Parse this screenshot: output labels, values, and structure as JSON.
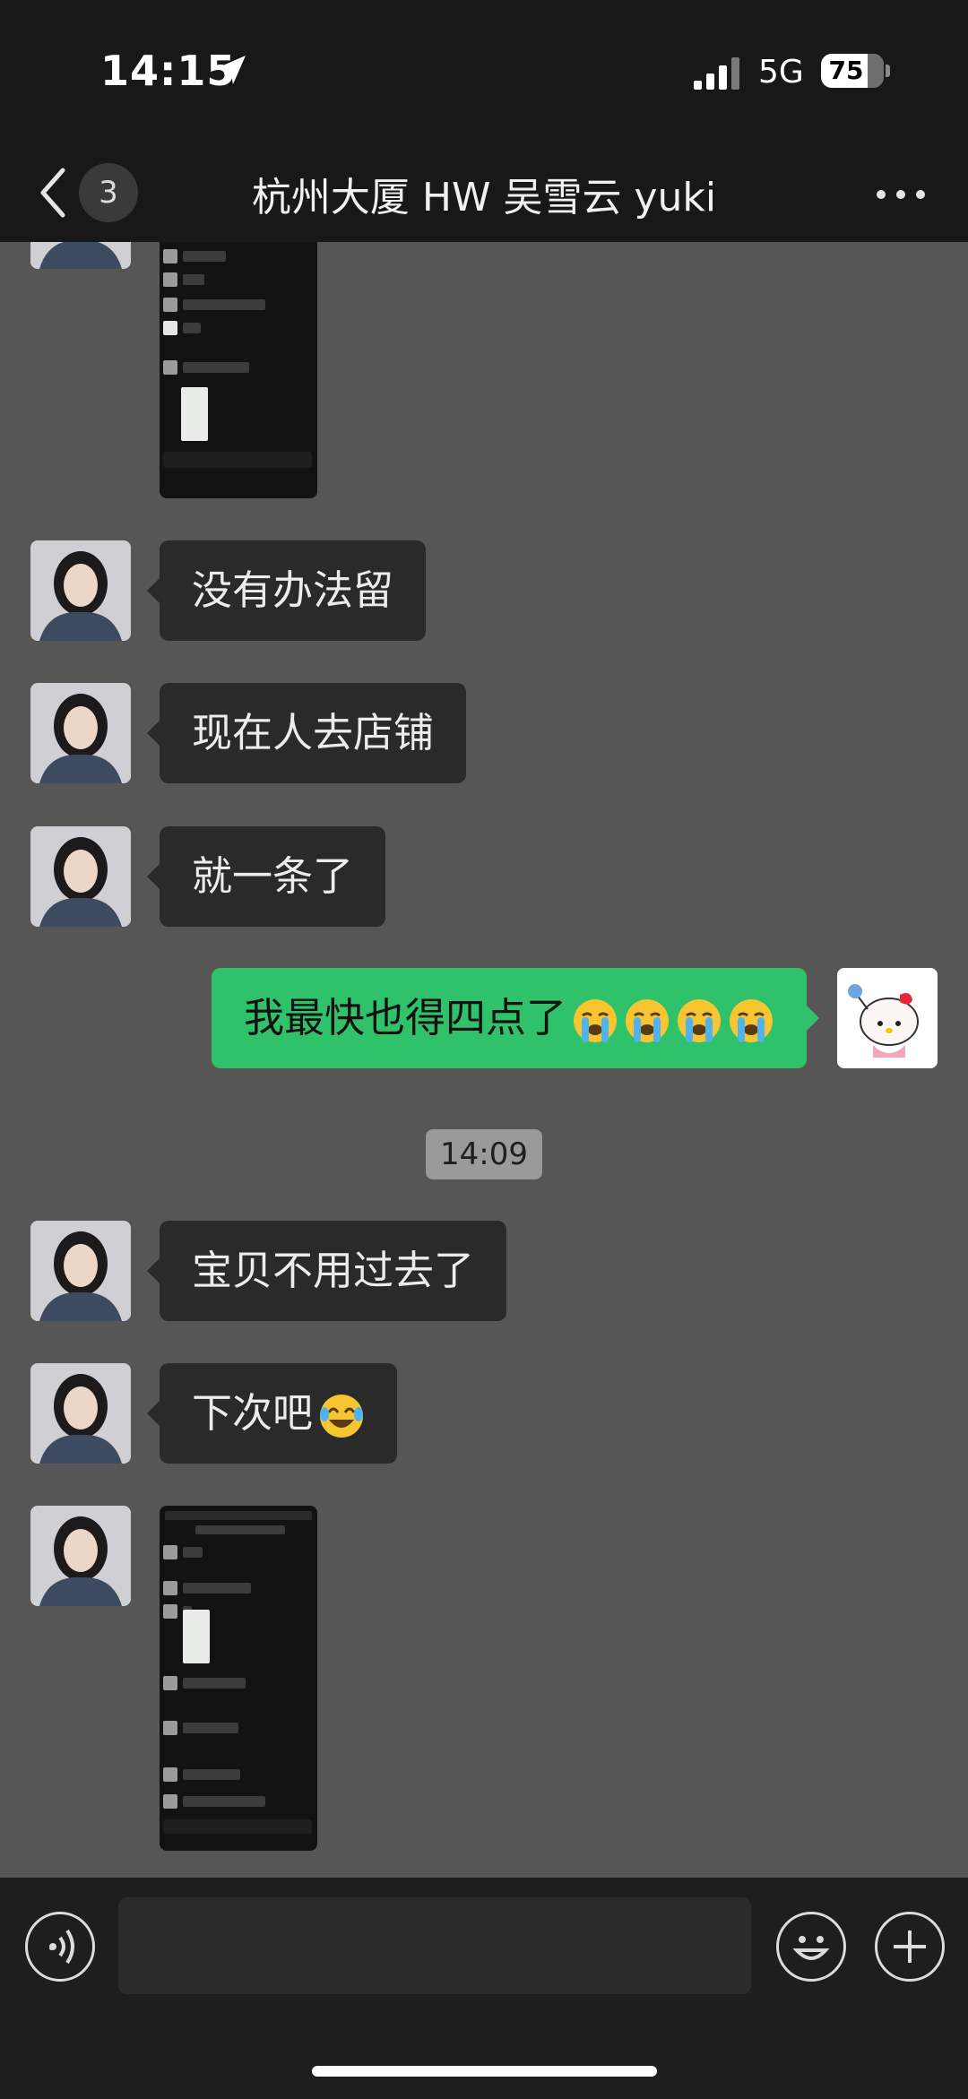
{
  "status_bar": {
    "time": "14:15",
    "network": "5G",
    "battery": "75",
    "location_icon": "location-arrow-icon",
    "signal_icon": "signal-bars-icon"
  },
  "nav": {
    "back_icon": "chevron-left-icon",
    "unread_count": "3",
    "title": "杭州大厦 HW 吴雪云 yuki",
    "more_icon": "more-dots-icon"
  },
  "messages": [
    {
      "type": "image",
      "sender": "contact",
      "description": "chat screenshot thumbnail"
    },
    {
      "type": "text",
      "sender": "contact",
      "text": "没有办法留"
    },
    {
      "type": "text",
      "sender": "contact",
      "text": "现在人去店铺"
    },
    {
      "type": "text",
      "sender": "contact",
      "text": "就一条了"
    },
    {
      "type": "text",
      "sender": "me",
      "text": "我最快也得四点了",
      "emoji": "crying-face-emoji x4"
    },
    {
      "type": "timestamp",
      "text": "14:09"
    },
    {
      "type": "text",
      "sender": "contact",
      "text": "宝贝不用过去了"
    },
    {
      "type": "text",
      "sender": "contact",
      "text": "下次吧",
      "emoji": "tears-of-joy-emoji"
    },
    {
      "type": "image",
      "sender": "contact",
      "description": "chat screenshot thumbnail"
    }
  ],
  "input_bar": {
    "voice_icon": "voice-icon",
    "emoji_icon": "smiley-icon",
    "plus_icon": "plus-icon"
  },
  "colors": {
    "background": "#565656",
    "bar": "#181818",
    "bubble_in": "#2a2a2a",
    "bubble_out": "#2fc26a",
    "timestamp_bg": "#9a9a9a"
  }
}
